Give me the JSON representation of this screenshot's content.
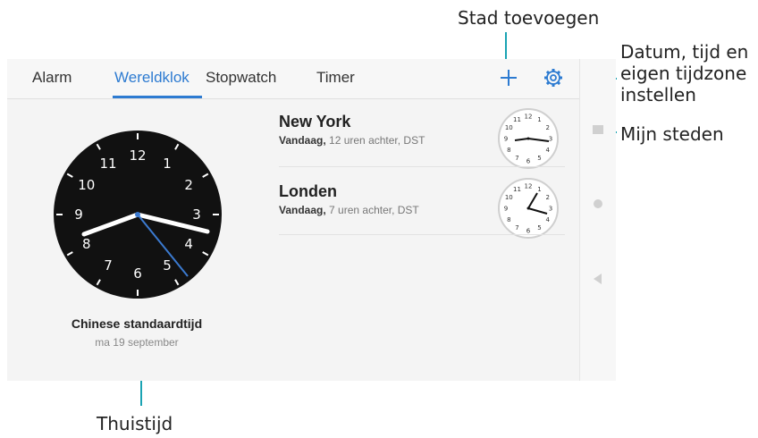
{
  "callouts": {
    "add_city": "Stad toevoegen",
    "settings": [
      "Datum, tijd en",
      "eigen tijdzone",
      "instellen"
    ],
    "my_cities": "Mijn steden",
    "home_time": "Thuistijd"
  },
  "tabs": [
    {
      "label": "Alarm",
      "active": false
    },
    {
      "label": "Wereldklok",
      "active": true
    },
    {
      "label": "Stopwatch",
      "active": false
    },
    {
      "label": "Timer",
      "active": false
    }
  ],
  "home": {
    "timezone": "Chinese standaardtijd",
    "date": "ma 19 september",
    "numerals": [
      "12",
      "1",
      "2",
      "3",
      "4",
      "5",
      "6",
      "7",
      "8",
      "9",
      "10",
      "11"
    ]
  },
  "cities": [
    {
      "name": "New York",
      "day": "Vandaag,",
      "offset": "12 uren achter, DST"
    },
    {
      "name": "Londen",
      "day": "Vandaag,",
      "offset": "7 uren achter, DST"
    }
  ],
  "colors": {
    "accent": "#2d7bd1",
    "callout_line": "#1aa3b3",
    "clock_face": "#111111"
  },
  "icons": {
    "add": "plus-icon",
    "settings": "gear-icon",
    "nav_home": "circle-icon",
    "nav_back": "triangle-back-icon",
    "nav_recent": "square-icon"
  }
}
